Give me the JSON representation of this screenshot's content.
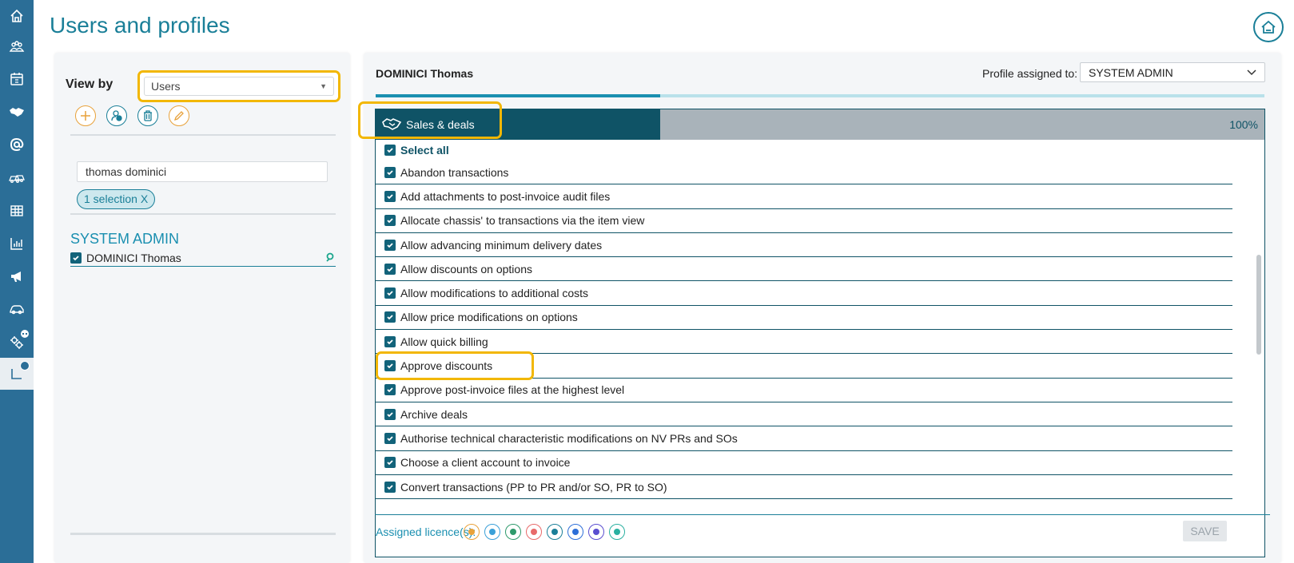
{
  "page": {
    "title": "Users and profiles"
  },
  "left": {
    "view_by_label": "View by",
    "view_by_value": "Users",
    "search_value": "thomas dominici",
    "selection_chip": "1 selection X",
    "group_title": "SYSTEM ADMIN",
    "user_name": "DOMINICI Thomas"
  },
  "right": {
    "user_title": "DOMINICI Thomas",
    "profile_label": "Profile assigned to:",
    "profile_value": "SYSTEM ADMIN",
    "progress_fraction": 0.32,
    "module": {
      "title": "Sales & deals",
      "percent": "100%"
    },
    "select_all": "Select all",
    "permissions": [
      "Abandon transactions",
      "Add attachments to post-invoice audit files",
      "Allocate chassis' to transactions via the item view",
      "Allow advancing minimum delivery dates",
      "Allow discounts on options",
      "Allow modifications to additional costs",
      "Allow price modifications on options",
      "Allow quick billing",
      "Approve discounts",
      "Approve post-invoice files at the highest level",
      "Archive deals",
      "Authorise technical characteristic modifications on NV PRs and SOs",
      "Choose a client account to invoice",
      "Convert transactions (PP to PR and/or SO, PR to SO)"
    ],
    "licences_label": "Assigned licence(s):",
    "save_label": "SAVE"
  },
  "colors": {
    "accent": "#1a7f98",
    "highlight": "#f2b705",
    "nav": "#2b6e97",
    "module_dark": "#0f5366"
  }
}
